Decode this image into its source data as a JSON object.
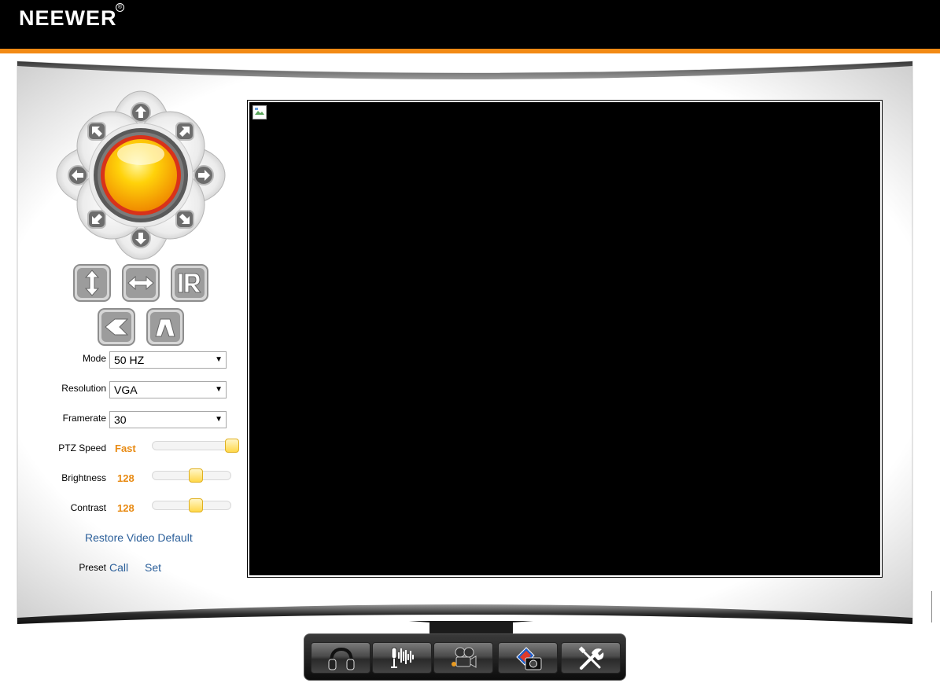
{
  "header": {
    "logo_text": "NEEWER",
    "logo_mark": "®",
    "brand_color": "#f28a14"
  },
  "controls": {
    "mode": {
      "label": "Mode",
      "value": "50 HZ"
    },
    "resolution": {
      "label": "Resolution",
      "value": "VGA"
    },
    "framerate": {
      "label": "Framerate",
      "value": "30"
    },
    "ptz_speed": {
      "label": "PTZ Speed",
      "value": "Fast",
      "level": 1.0
    },
    "brightness": {
      "label": "Brightness",
      "value": "128",
      "level": 0.5
    },
    "contrast": {
      "label": "Contrast",
      "value": "128",
      "level": 0.5
    },
    "restore_link": "Restore Video Default",
    "preset": {
      "label": "Preset",
      "call": "Call",
      "set": "Set"
    },
    "accent_color": "#e88a12"
  },
  "ptz_buttons": [
    "up-arrow-icon",
    "down-arrow-icon",
    "left-arrow-icon",
    "right-arrow-icon",
    "up-left-arrow-icon",
    "up-right-arrow-icon",
    "down-left-arrow-icon",
    "down-right-arrow-icon"
  ],
  "square_buttons": [
    "vertical-flip-icon",
    "horizontal-flip-icon",
    "ir-icon",
    "left-chevron-icon",
    "up-chevron-icon"
  ],
  "toolbar": [
    "headphones-icon",
    "microphone-icon",
    "video-camera-icon",
    "snapshot-icon",
    "tools-icon"
  ]
}
